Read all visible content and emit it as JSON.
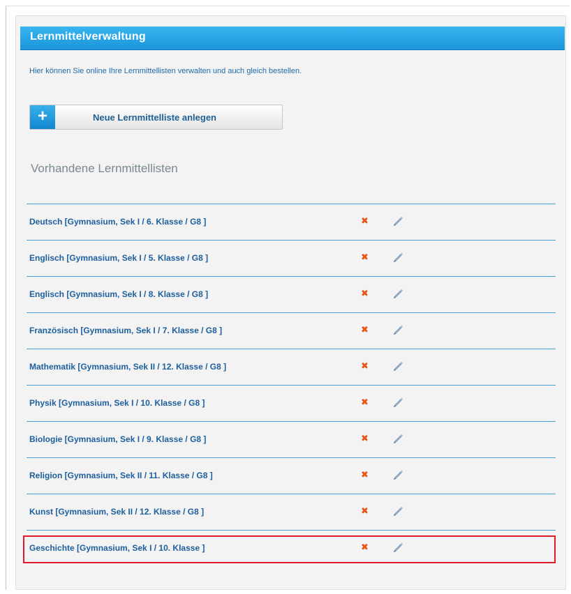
{
  "header": {
    "title": "Lernmittelverwaltung"
  },
  "intro_text": "Hier können Sie online Ihre Lernmittellisten verwalten und auch gleich bestellen.",
  "new_button": {
    "icon": "+",
    "label": "Neue Lernmittelliste anlegen"
  },
  "section_title": "Vorhandene Lernmittellisten",
  "lists": [
    {
      "label": "Deutsch [Gymnasium, Sek I / 6. Klasse / G8 ]"
    },
    {
      "label": "Englisch [Gymnasium, Sek I / 5. Klasse / G8 ]"
    },
    {
      "label": "Englisch [Gymnasium, Sek I / 8. Klasse / G8 ]"
    },
    {
      "label": "Französisch [Gymnasium, Sek I / 7. Klasse / G8 ]"
    },
    {
      "label": "Mathematik [Gymnasium, Sek II / 12. Klasse / G8 ]"
    },
    {
      "label": "Physik [Gymnasium, Sek I / 10. Klasse / G8 ]"
    },
    {
      "label": "Biologie [Gymnasium, Sek I / 9. Klasse / G8 ]"
    },
    {
      "label": "Religion [Gymnasium, Sek II / 11. Klasse / G8 ]"
    },
    {
      "label": "Kunst [Gymnasium, Sek II / 12. Klasse / G8 ]"
    },
    {
      "label": "Geschichte [Gymnasium, Sek I / 10. Klasse ]",
      "highlighted": true
    }
  ],
  "icons": {
    "delete": "delete-x-icon",
    "edit": "pencil-edit-icon"
  },
  "colors": {
    "accent": "#1a95db",
    "link": "#1d5f9e",
    "delete": "#e8520e",
    "highlight": "#e0192d"
  }
}
